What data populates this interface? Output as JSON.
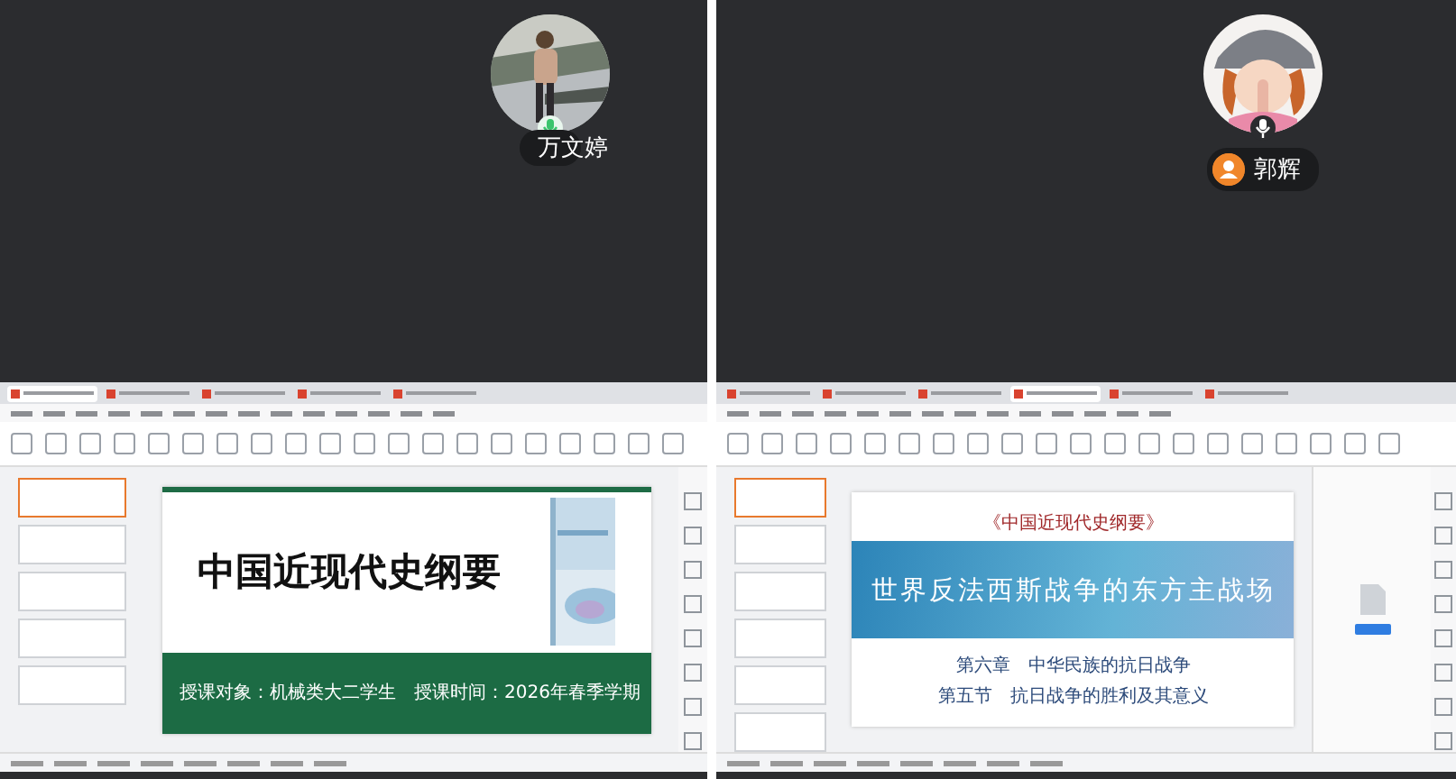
{
  "panels": [
    {
      "participant": {
        "name": "万文婷",
        "kind": "mic"
      },
      "side_pane": false,
      "document_tabs": [
        {
          "selected": true
        },
        {
          "selected": false
        },
        {
          "selected": false
        },
        {
          "selected": false
        },
        {
          "selected": false
        }
      ],
      "thumbnails": [
        {
          "selected": true
        },
        {
          "selected": false
        },
        {
          "selected": false
        },
        {
          "selected": false
        },
        {
          "selected": false
        }
      ],
      "slide": {
        "kind": "green",
        "title": "中国近现代史纲要",
        "footer": "授课对象：机械类大二学生　授课时间：2026年春季学期"
      }
    },
    {
      "participant": {
        "name": "郭辉",
        "kind": "user"
      },
      "side_pane": true,
      "document_tabs": [
        {
          "selected": false
        },
        {
          "selected": false
        },
        {
          "selected": false
        },
        {
          "selected": true
        },
        {
          "selected": false
        },
        {
          "selected": false
        }
      ],
      "thumbnails": [
        {
          "selected": true
        },
        {
          "selected": false
        },
        {
          "selected": false
        },
        {
          "selected": false
        },
        {
          "selected": false
        },
        {
          "selected": false
        }
      ],
      "slide": {
        "kind": "blue",
        "series": "《中国近现代史纲要》",
        "title": "世界反法西斯战争的东方主战场",
        "lines": [
          "第六章　中华民族的抗日战争",
          "第五节　抗日战争的胜利及其意义"
        ]
      }
    }
  ]
}
